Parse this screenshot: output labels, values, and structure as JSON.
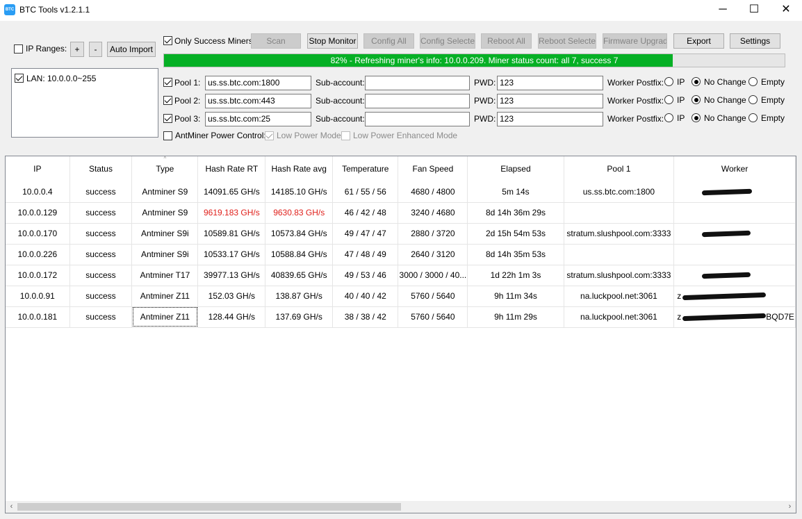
{
  "window": {
    "title": "BTC Tools v1.2.1.1",
    "icon_text": "BTC",
    "minimize": "─",
    "maximize": "☐",
    "close": "✕"
  },
  "toolbar": {
    "ip_ranges_label": "IP Ranges:",
    "plus": "+",
    "minus": "-",
    "auto_import": "Auto Import",
    "only_success_label": "Only Success Miners",
    "scan": "Scan",
    "stop_monitor": "Stop Monitor",
    "config_all": "Config All",
    "config_selected": "Config Selected",
    "reboot_all": "Reboot All",
    "reboot_selected": "Reboot Selected",
    "firmware_upgrade": "Firmware Upgrade",
    "export": "Export",
    "settings": "Settings"
  },
  "ip_ranges": [
    {
      "label": "LAN: 10.0.0.0~255",
      "checked": true
    }
  ],
  "progress": {
    "percent": 82,
    "text": "82% - Refreshing miner's info: 10.0.0.209. Miner status count: all 7, success 7"
  },
  "pools": [
    {
      "label": "Pool 1:",
      "url": "us.ss.btc.com:1800",
      "sub_label": "Sub-account:",
      "sub": "",
      "pwd_label": "PWD:",
      "pwd": "123",
      "postfix_label": "Worker Postfix:",
      "options": [
        "IP",
        "No Change",
        "Empty"
      ],
      "selected": "No Change"
    },
    {
      "label": "Pool 2:",
      "url": "us.ss.btc.com:443",
      "sub_label": "Sub-account:",
      "sub": "",
      "pwd_label": "PWD:",
      "pwd": "123",
      "postfix_label": "Worker Postfix:",
      "options": [
        "IP",
        "No Change",
        "Empty"
      ],
      "selected": "No Change"
    },
    {
      "label": "Pool 3:",
      "url": "us.ss.btc.com:25",
      "sub_label": "Sub-account:",
      "sub": "",
      "pwd_label": "PWD:",
      "pwd": "123",
      "postfix_label": "Worker Postfix:",
      "options": [
        "IP",
        "No Change",
        "Empty"
      ],
      "selected": "No Change"
    }
  ],
  "power": {
    "label": "AntMiner Power Control:",
    "low_power": "Low Power Mode",
    "low_power_enhanced": "Low Power Enhanced Mode"
  },
  "table": {
    "columns": [
      "IP",
      "Status",
      "Type",
      "Hash Rate RT",
      "Hash Rate avg",
      "Temperature",
      "Fan Speed",
      "Elapsed",
      "Pool 1",
      "Worker"
    ],
    "rows": [
      {
        "ip": "10.0.0.4",
        "status": "success",
        "type": "Antminer S9",
        "rt": "14091.65 GH/s",
        "avg": "14185.10 GH/s",
        "temp": "61 / 55 / 56",
        "fan": "4680 / 4800",
        "elapsed": "5m 14s",
        "pool": "us.ss.btc.com:1800",
        "worker": "",
        "low": false
      },
      {
        "ip": "10.0.0.129",
        "status": "success",
        "type": "Antminer S9",
        "rt": "9619.183 GH/s",
        "avg": "9630.83 GH/s",
        "temp": "46 / 42 / 48",
        "fan": "3240 / 4680",
        "elapsed": "8d 14h 36m 29s",
        "pool": "",
        "worker": "",
        "low": true
      },
      {
        "ip": "10.0.0.170",
        "status": "success",
        "type": "Antminer S9i",
        "rt": "10589.81 GH/s",
        "avg": "10573.84 GH/s",
        "temp": "49 / 47 / 47",
        "fan": "2880 / 3720",
        "elapsed": "2d 15h 54m 53s",
        "pool": "stratum.slushpool.com:3333",
        "worker": "",
        "low": false
      },
      {
        "ip": "10.0.0.226",
        "status": "success",
        "type": "Antminer S9i",
        "rt": "10533.17 GH/s",
        "avg": "10588.84 GH/s",
        "temp": "47 / 48 / 49",
        "fan": "2640 / 3120",
        "elapsed": "8d 14h 35m 53s",
        "pool": "",
        "worker": "",
        "low": false
      },
      {
        "ip": "10.0.0.172",
        "status": "success",
        "type": "Antminer T17",
        "rt": "39977.13 GH/s",
        "avg": "40839.65 GH/s",
        "temp": "49 / 53 / 46",
        "fan": "3000 / 3000 / 40...",
        "elapsed": "1d 22h 1m 3s",
        "pool": "stratum.slushpool.com:3333",
        "worker": "",
        "low": false
      },
      {
        "ip": "10.0.0.91",
        "status": "success",
        "type": "Antminer Z11",
        "rt": "152.03 GH/s",
        "avg": "138.87 GH/s",
        "temp": "40 / 40 / 42",
        "fan": "5760 / 5640",
        "elapsed": "9h 11m 34s",
        "pool": "na.luckpool.net:3061",
        "worker": "z",
        "low": false
      },
      {
        "ip": "10.0.0.181",
        "status": "success",
        "type": "Antminer Z11",
        "rt": "128.44 GH/s",
        "avg": "137.69 GH/s",
        "temp": "38 / 38 / 42",
        "fan": "5760 / 5640",
        "elapsed": "9h 11m 29s",
        "pool": "na.luckpool.net:3061",
        "worker": "z",
        "worker_tail": "BQD7E",
        "low": false
      }
    ]
  },
  "scrollbar": {
    "left": "‹",
    "right": "›"
  },
  "colors": {
    "progress": "#06b025",
    "warning_text": "#e0201b"
  }
}
